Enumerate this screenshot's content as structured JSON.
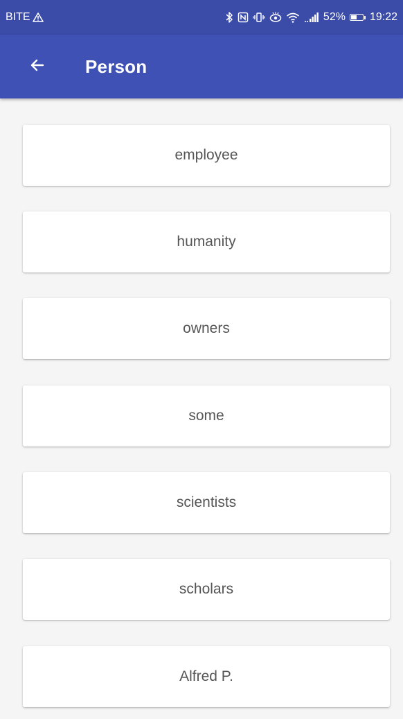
{
  "status_bar": {
    "carrier": "BITE",
    "battery_percent": "52%",
    "battery_level": 0.52,
    "time": "19:22",
    "icons": [
      "warning-icon",
      "bluetooth-icon",
      "nfc-icon",
      "vibrate-icon",
      "eye-comfort-icon",
      "wifi-icon",
      "signal-icon",
      "battery-icon"
    ]
  },
  "app_bar": {
    "back_icon": "arrow-back-icon",
    "title": "Person",
    "color": "#3f51b5"
  },
  "list": {
    "items": [
      {
        "label": "employee"
      },
      {
        "label": "humanity"
      },
      {
        "label": "owners"
      },
      {
        "label": "some"
      },
      {
        "label": "scientists"
      },
      {
        "label": "scholars"
      },
      {
        "label": "Alfred P."
      }
    ]
  }
}
